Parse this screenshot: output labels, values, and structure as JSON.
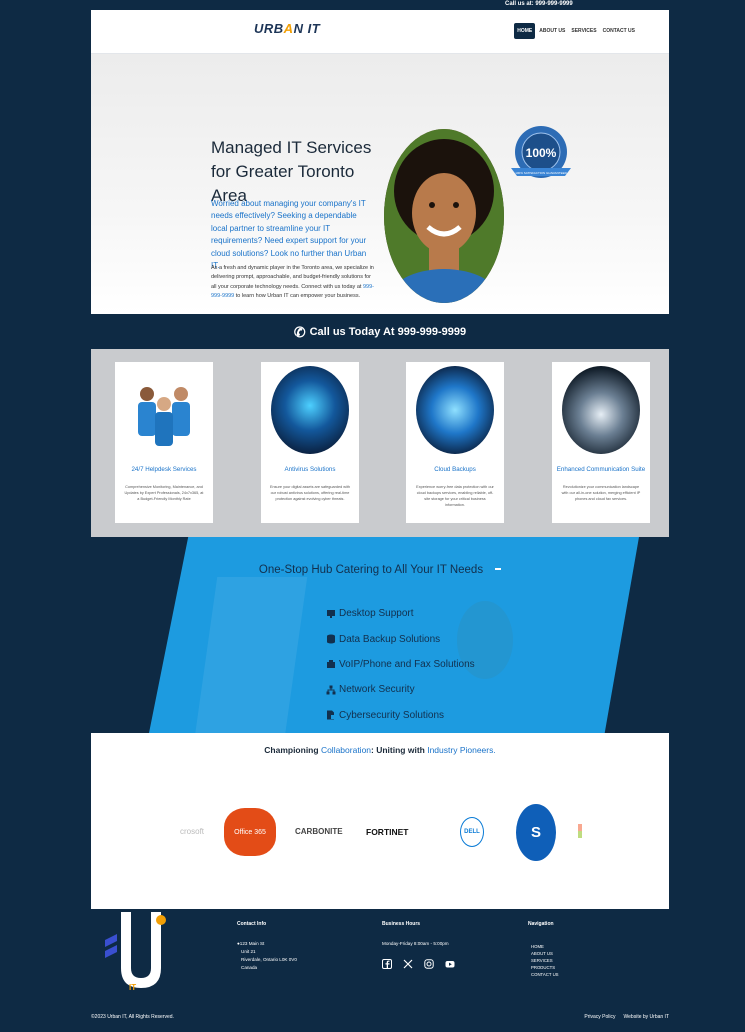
{
  "topbar": {
    "phone_text": "Call us at: 999-999-9999"
  },
  "header": {
    "logo_prefix": "URB",
    "logo_a": "A",
    "logo_mid": "N I",
    "logo_suffix": "T",
    "nav": [
      "HOME",
      "ABOUT US",
      "SERVICES",
      "CONTACT US"
    ],
    "active_nav": "HOME"
  },
  "hero": {
    "title": "Managed IT Services for Greater Toronto Area",
    "lead": "Worried about managing your company's IT needs effectively? Seeking a dependable local partner to streamline your IT requirements? Need expert support for your cloud solutions? Look no further than Urban IT.",
    "body_pre": "As a fresh and dynamic player in the Toronto area, we specialize in delivering prompt, approachable, and budget-friendly solutions for all your corporate technology needs. Connect with us today at ",
    "body_phone": "999-999-9999",
    "body_post": " to learn how Urban IT can empower your business.",
    "seal_big": "100%",
    "seal_ribbon": "100% SATISFACTION GUARANTEED",
    "seal_ring": "SATISFACTION GUARANTEED"
  },
  "callbar": {
    "text": "Call us Today At 999-999-9999"
  },
  "services": [
    {
      "title": "24/7 Helpdesk Services",
      "desc": "Comprehensive Monitoring, Maintenance, and Updates by Expert Professionals, 24x7x365, at a Budget-Friendly Monthly Rate"
    },
    {
      "title": "Antivirus Solutions",
      "desc": "Ensure your digital assets are safeguarded with our robust antivirus solutions, offering real-time protection against evolving cyber threats."
    },
    {
      "title": "Cloud Backups",
      "desc": "Experience worry-free data protection with our cloud backups services, enabling reliable, off-site storage for your critical business information."
    },
    {
      "title": "Enhanced Communication Suite",
      "desc": "Revolutionize your communication landscape with our all-in-one solution, merging efficient IP phones and cloud fax services."
    }
  ],
  "hub": {
    "title": "One-Stop Hub Catering to All Your IT Needs",
    "items": [
      "Desktop Support",
      "Data Backup Solutions",
      "VoIP/Phone and Fax Solutions",
      "Network Security",
      "Cybersecurity Solutions"
    ]
  },
  "partners": {
    "title_pre": "Championing ",
    "title_hl1": "Collaboration",
    "title_mid": ": Uniting with ",
    "title_hl2": "Industry Pioneers.",
    "logos": [
      "crosoft",
      "Office 365",
      "CARBONITE",
      "FORTINET",
      "DELL",
      "S"
    ]
  },
  "footer": {
    "contact_title": "Contact Info",
    "address": [
      "123 Main St",
      "Unit 21",
      "Riverdale, Ontario L0K 0V0",
      "Canada"
    ],
    "hours_title": "Business Hours",
    "hours": "Monday-Friday 8:00am - 5:00pm",
    "nav_title": "Navigation",
    "nav": [
      "HOME",
      "ABOUT US",
      "SERVICES",
      "PRODUCTS",
      "CONTACT US"
    ],
    "copyright": "©2023 Urban IT, All Rights Reserved.",
    "privacy": "Privacy Policy",
    "credit": "Website by Urban IT",
    "logo_it": "IT"
  },
  "colors": {
    "navy": "#0e2a44",
    "accent_blue": "#1a73c9",
    "hub_blue": "#1d9be0",
    "orange": "#f29f05"
  }
}
